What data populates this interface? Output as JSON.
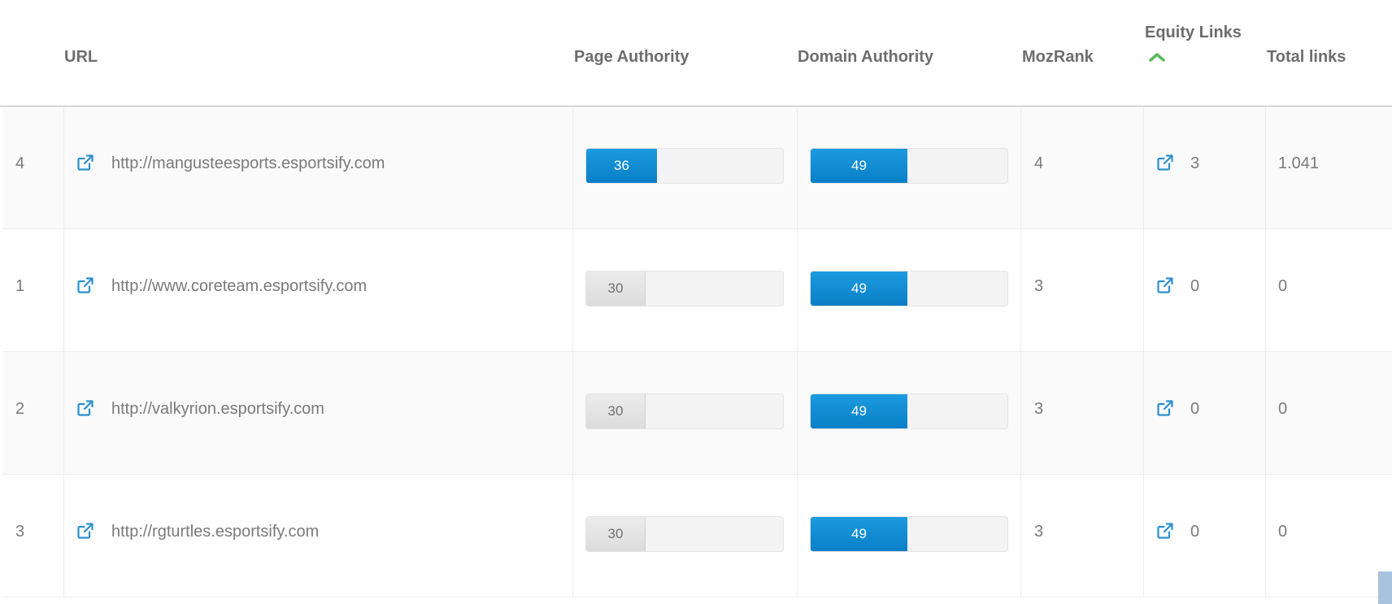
{
  "columns": {
    "url": "URL",
    "page_authority": "Page Authority",
    "domain_authority": "Domain Authority",
    "mozrank": "MozRank",
    "equity_links": "Equity Links",
    "total_links": "Total links"
  },
  "sort": {
    "column": "equity_links",
    "direction": "ascending",
    "icon": "chevron-up-icon",
    "color": "#5cb85c"
  },
  "accent_color": "#0a7fc6",
  "link_icon": "external-link-icon",
  "rows": [
    {
      "index": "4",
      "url": "http://mangusteesports.esportsify.com",
      "page_authority": "36",
      "page_authority_level": 36,
      "page_authority_style": "blue",
      "domain_authority": "49",
      "domain_authority_level": 49,
      "mozrank": "4",
      "equity_links": "3",
      "total_links": "1.041"
    },
    {
      "index": "1",
      "url": "http://www.coreteam.esportsify.com",
      "page_authority": "30",
      "page_authority_level": 30,
      "page_authority_style": "gray",
      "domain_authority": "49",
      "domain_authority_level": 49,
      "mozrank": "3",
      "equity_links": "0",
      "total_links": "0"
    },
    {
      "index": "2",
      "url": "http://valkyrion.esportsify.com",
      "page_authority": "30",
      "page_authority_level": 30,
      "page_authority_style": "gray",
      "domain_authority": "49",
      "domain_authority_level": 49,
      "mozrank": "3",
      "equity_links": "0",
      "total_links": "0"
    },
    {
      "index": "3",
      "url": "http://rgturtles.esportsify.com",
      "page_authority": "30",
      "page_authority_level": 30,
      "page_authority_style": "gray",
      "domain_authority": "49",
      "domain_authority_level": 49,
      "mozrank": "3",
      "equity_links": "0",
      "total_links": "0"
    }
  ]
}
